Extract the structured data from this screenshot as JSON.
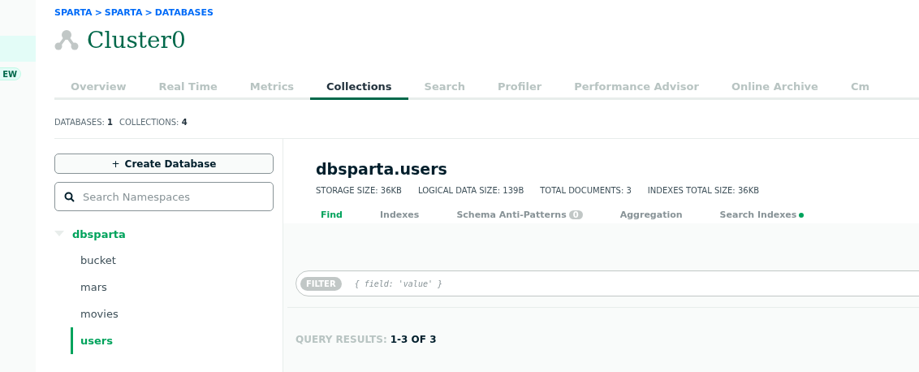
{
  "sidebar": {
    "highlight": true,
    "badge": "EW"
  },
  "breadcrumb": [
    {
      "label": "SPARTA"
    },
    {
      "label": "SPARTA"
    },
    {
      "label": "DATABASES"
    }
  ],
  "breadcrumb_separator": ">",
  "cluster": {
    "title": "Cluster0"
  },
  "tabs": [
    {
      "label": "Overview",
      "selected": false
    },
    {
      "label": "Real Time",
      "selected": false
    },
    {
      "label": "Metrics",
      "selected": false
    },
    {
      "label": "Collections",
      "selected": true
    },
    {
      "label": "Search",
      "selected": false
    },
    {
      "label": "Profiler",
      "selected": false
    },
    {
      "label": "Performance Advisor",
      "selected": false
    },
    {
      "label": "Online Archive",
      "selected": false
    },
    {
      "label": "Cm",
      "selected": false
    }
  ],
  "counts": [
    {
      "label": "DATABASES:",
      "value": "1"
    },
    {
      "label": "COLLECTIONS:",
      "value": "4"
    }
  ],
  "create_button": {
    "icon": "+",
    "label": "Create Database"
  },
  "search": {
    "placeholder": "Search Namespaces"
  },
  "tree": [
    {
      "label": "dbsparta",
      "expanded": true,
      "selected": true,
      "children": [
        {
          "label": "bucket",
          "selected": false
        },
        {
          "label": "mars",
          "selected": false
        },
        {
          "label": "movies",
          "selected": false
        },
        {
          "label": "users",
          "selected": true
        }
      ]
    }
  ],
  "collection": {
    "title": "dbsparta.users",
    "stats": [
      {
        "label": "STORAGE SIZE:",
        "value": "36KB"
      },
      {
        "label": "LOGICAL DATA SIZE:",
        "value": "139B"
      },
      {
        "label": "TOTAL DOCUMENTS:",
        "value": "3"
      },
      {
        "label": "INDEXES TOTAL SIZE:",
        "value": "36KB"
      }
    ],
    "tabs": [
      {
        "label": "Find",
        "selected": true
      },
      {
        "label": "Indexes",
        "selected": false
      },
      {
        "label": "Schema Anti-Patterns",
        "selected": false,
        "count": "0"
      },
      {
        "label": "Aggregation",
        "selected": false
      },
      {
        "label": "Search Indexes",
        "selected": false,
        "dot": true
      }
    ],
    "filter": {
      "tag": "FILTER",
      "placeholder": "{ field: 'value' }"
    },
    "results": {
      "label": "QUERY RESULTS:",
      "value": "1-3 OF 3"
    }
  }
}
